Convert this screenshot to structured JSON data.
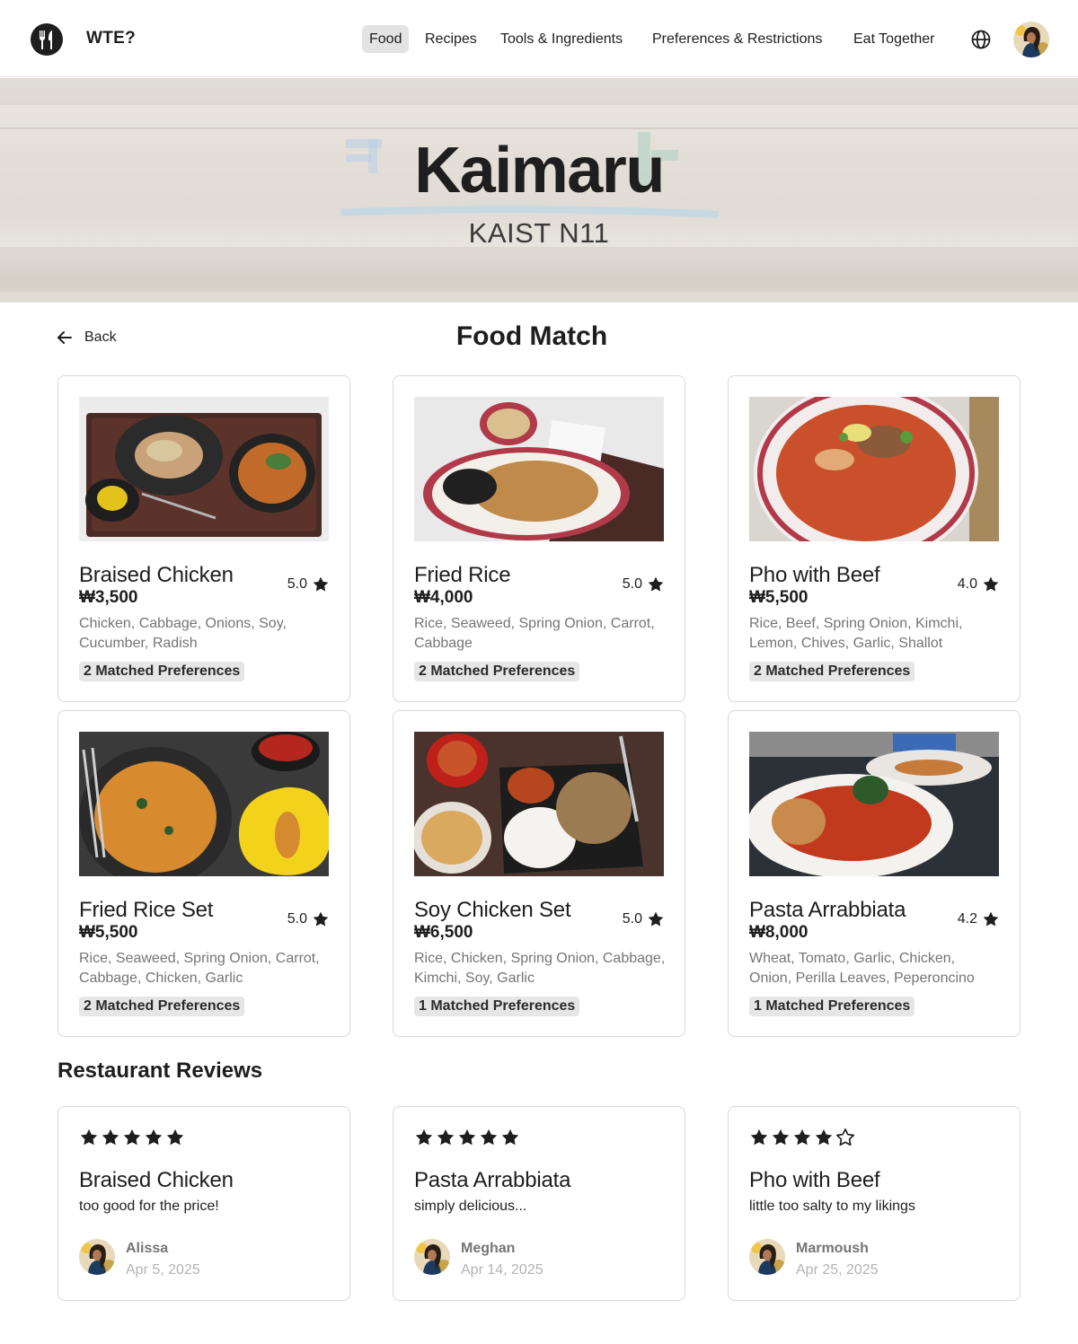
{
  "header": {
    "brand": "WTE?",
    "nav": [
      {
        "label": "Food",
        "active": true
      },
      {
        "label": "Recipes",
        "active": false
      },
      {
        "label": "Tools & Ingredients",
        "active": false
      },
      {
        "label": "Preferences & Restrictions",
        "active": false
      },
      {
        "label": "Eat Together",
        "active": false
      }
    ],
    "icons": {
      "logo": "fork-knife-logo-icon",
      "language": "globe-icon",
      "profile": "user-avatar"
    }
  },
  "hero": {
    "title": "Kaimaru",
    "subtitle": "KAIST N11"
  },
  "page": {
    "back_label": "Back",
    "title": "Food Match"
  },
  "foods": [
    {
      "name": "Braised Chicken",
      "price": "₩3,500",
      "rating": "5.0",
      "ingredients": "Chicken, Cabbage, Onions, Soy, Cucumber, Radish",
      "matched": "2 Matched Preferences"
    },
    {
      "name": "Fried Rice",
      "price": "₩4,000",
      "rating": "5.0",
      "ingredients": "Rice, Seaweed, Spring Onion, Carrot, Cabbage",
      "matched": "2 Matched Preferences"
    },
    {
      "name": "Pho with Beef",
      "price": "₩5,500",
      "rating": "4.0",
      "ingredients": "Rice, Beef, Spring Onion, Kimchi, Lemon, Chives, Garlic, Shallot",
      "matched": "2 Matched Preferences"
    },
    {
      "name": "Fried Rice Set",
      "price": "₩5,500",
      "rating": "5.0",
      "ingredients": "Rice, Seaweed, Spring Onion, Carrot, Cabbage, Chicken, Garlic",
      "matched": "2 Matched Preferences"
    },
    {
      "name": "Soy Chicken Set",
      "price": "₩6,500",
      "rating": "5.0",
      "ingredients": "Rice, Chicken, Spring Onion, Cabbage, Kimchi, Soy, Garlic",
      "matched": "1 Matched Preferences"
    },
    {
      "name": "Pasta Arrabbiata",
      "price": "₩8,000",
      "rating": "4.2",
      "ingredients": "Wheat, Tomato, Garlic, Chicken, Onion, Perilla Leaves, Peperoncino",
      "matched": "1 Matched Preferences"
    }
  ],
  "reviews_title": "Restaurant Reviews",
  "reviews": [
    {
      "stars": 5,
      "dish": "Braised Chicken",
      "text": "too good for the price!",
      "author": "Alissa",
      "date": "Apr 5, 2025"
    },
    {
      "stars": 5,
      "dish": "Pasta Arrabbiata",
      "text": "simply delicious...",
      "author": "Meghan",
      "date": "Apr 14, 2025"
    },
    {
      "stars": 4,
      "dish": "Pho with Beef",
      "text": "little too salty to my likings",
      "author": "Marmoush",
      "date": "Apr 25, 2025"
    }
  ]
}
